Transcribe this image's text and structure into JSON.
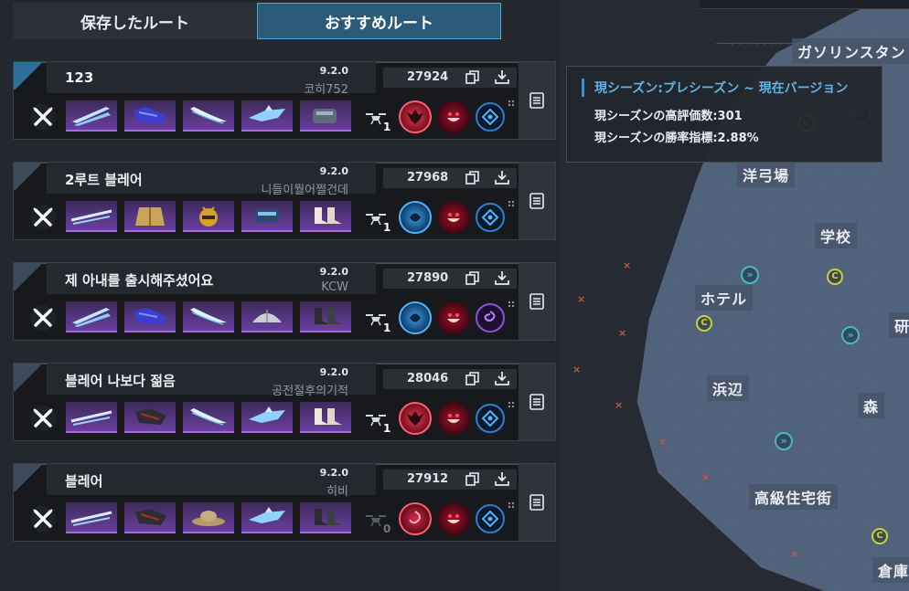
{
  "tabs": [
    {
      "label": "保存したルート",
      "active": false
    },
    {
      "label": "おすすめルート",
      "active": true
    }
  ],
  "routes": [
    {
      "title": "123",
      "version": "9.2.0",
      "author": "코히752",
      "score": "27924",
      "drones": "1",
      "weapon": "dual-blade",
      "items": [
        "dual-blades",
        "purple-armor",
        "curved-blade",
        "shark-blade",
        "gauntlet"
      ],
      "traits": [
        "red-demon",
        "red-grin",
        "blue-gem"
      ]
    },
    {
      "title": "2루트 블레어",
      "version": "9.2.0",
      "author": "니들이뭘어쩔건데",
      "score": "27968",
      "drones": "1",
      "weapon": "dual-blade",
      "items": [
        "twin-spears",
        "gold-jacket",
        "gold-helmet",
        "blue-bracer",
        "white-boots"
      ],
      "traits": [
        "blue-orb",
        "red-grin",
        "blue-gem"
      ]
    },
    {
      "title": "제 아내를 출시해주셨어요",
      "version": "9.2.0",
      "author": "KCW",
      "score": "27890",
      "drones": "1",
      "weapon": "dual-blade",
      "items": [
        "dual-blades",
        "purple-armor",
        "curved-blade",
        "silver-shell",
        "dark-boots"
      ],
      "traits": [
        "blue-orb",
        "red-grin",
        "purple-swirl"
      ]
    },
    {
      "title": "블레어 나보다 젊음",
      "version": "9.2.0",
      "author": "공전절후의기적",
      "score": "28046",
      "drones": "1",
      "weapon": "dual-blade",
      "items": [
        "twin-spears",
        "dark-armor",
        "curved-blade",
        "shark-blade",
        "white-boots"
      ],
      "traits": [
        "red-demon",
        "red-grin",
        "blue-gem"
      ]
    },
    {
      "title": "블레어",
      "version": "9.2.0",
      "author": "히비",
      "score": "27912",
      "drones": "0",
      "weapon": "dual-blade",
      "items": [
        "twin-spears",
        "dark-armor",
        "straw-hat",
        "shark-blade",
        "dark-boots"
      ],
      "traits": [
        "red-swirl",
        "red-grin",
        "blue-gem"
      ]
    }
  ],
  "tooltip": {
    "heading": "現シーズン:プレシーズン ~ 現在バージョン",
    "high_rating": "現シーズンの高評価数:301",
    "win_rate": "現シーズンの勝率指標:2.88%"
  },
  "map": {
    "labels": [
      "ガソリンスタンド",
      "洋弓場",
      "学校",
      "ホテル",
      "研",
      "浜辺",
      "森",
      "高級住宅街",
      "倉庫"
    ]
  },
  "colors": {
    "accent": "#4ea7d4",
    "item_rarity": "#a368e8",
    "tooltip_heading": "#5fb3e6"
  }
}
